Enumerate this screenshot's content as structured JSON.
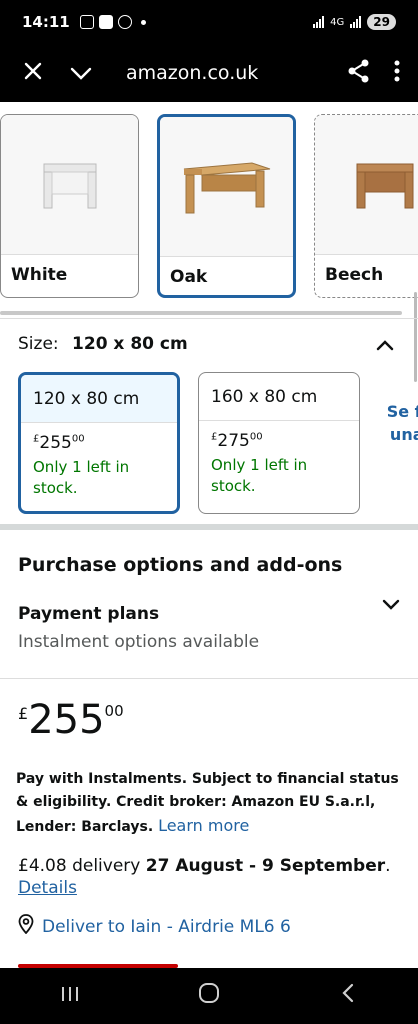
{
  "status_bar": {
    "time": "14:11",
    "network": "4G",
    "battery": "29"
  },
  "browser": {
    "url": "amazon.co.uk"
  },
  "styles": [
    {
      "label": "White",
      "selected": false,
      "color": "#f0f0f0"
    },
    {
      "label": "Oak",
      "selected": true,
      "color": "#c99a5b"
    },
    {
      "label": "Beech",
      "selected": false,
      "color": "#b67c4b"
    }
  ],
  "size": {
    "label": "Size:",
    "value": "120 x 80 cm",
    "options": [
      {
        "name": "120 x 80 cm",
        "currency": "£",
        "whole": "255",
        "fraction": "00",
        "stock": "Only 1 left in stock.",
        "selected": true
      },
      {
        "name": "160 x 80 cm",
        "currency": "£",
        "whole": "275",
        "fraction": "00",
        "stock": "Only 1 left in stock.",
        "selected": false
      }
    ],
    "see_more_fragment": "Se fea una o"
  },
  "purchase": {
    "title": "Purchase options and add-ons",
    "payment_plans": "Payment plans",
    "payment_sub": "Instalment options available"
  },
  "price": {
    "currency": "£",
    "whole": "255",
    "fraction": "00"
  },
  "instalment": {
    "text": "Pay with Instalments. Subject to financial status & eligibility. Credit broker: Amazon EU S.a.r.l, Lender: Barclays.",
    "link": "Learn more"
  },
  "delivery": {
    "prefix": "£4.08 delivery",
    "dates": "27 August - 9 September",
    "suffix": ".",
    "details": "Details",
    "deliver_to": "Deliver to Iain - Airdrie ML6 6"
  },
  "colors": {
    "accent": "#2162a1",
    "stock_green": "#007600"
  }
}
